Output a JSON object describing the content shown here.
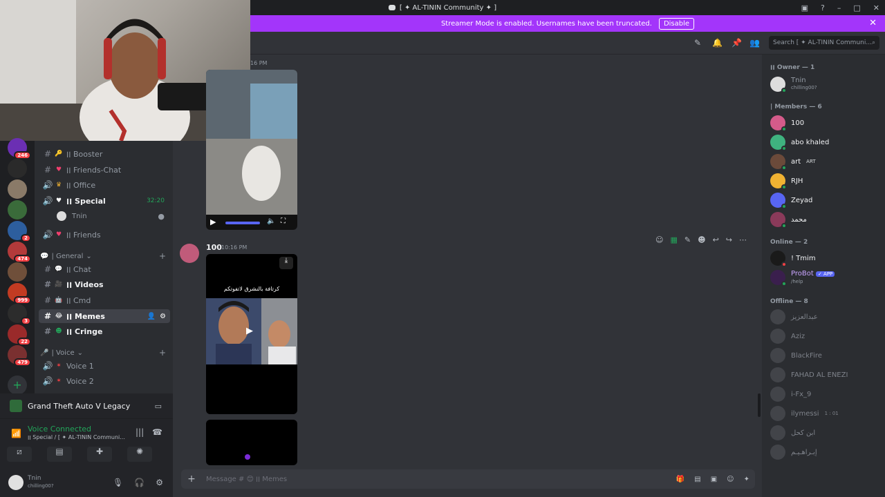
{
  "window": {
    "title": "[ ✦ AL-TININ Community ✦ ]"
  },
  "banner": {
    "text": "Streamer Mode is enabled. Usernames have been truncated.",
    "button": "Disable"
  },
  "search": {
    "placeholder": "Search [ ✦ AL-TININ Communi..."
  },
  "servers": [
    {
      "badge": "246"
    },
    {
      "badge": ""
    },
    {
      "badge": ""
    },
    {
      "badge": ""
    },
    {
      "badge": "2"
    },
    {
      "badge": "474"
    },
    {
      "badge": ""
    },
    {
      "badge": "999"
    },
    {
      "badge": "3"
    },
    {
      "badge": "22"
    },
    {
      "badge": "479"
    }
  ],
  "channels": {
    "booster": "׀׀ Booster",
    "friends_chat": "׀׀ Friends-Chat",
    "office": "׀׀ Office",
    "special": "׀׀ Special",
    "special_time": "32:20",
    "special_user": "Tnin",
    "friends": "׀׀ Friends",
    "cat_general": "| General",
    "chat": "׀׀ Chat",
    "videos": "׀׀ Videos",
    "cmd": "׀׀ Cmd",
    "memes": "׀׀ Memes",
    "cringe": "׀׀ Cringe",
    "cat_voice": "| Voice",
    "voice1": "Voice 1",
    "voice2": "Voice 2"
  },
  "game": {
    "name": "Grand Theft Auto V Legacy"
  },
  "voice": {
    "status": "Voice Connected",
    "channel": "׀׀ Special / [ ✦ AL-TININ Communi..."
  },
  "user": {
    "name": "Tnin",
    "status": "chilling00?"
  },
  "chat": {
    "prev_time": "16 PM",
    "msg_author": "100",
    "msg_time": "10:16 PM",
    "video_caption": "كرتافة بالنشرق لاتفوتكم",
    "composer_placeholder": "Message # 😊 ׀׀ Memes"
  },
  "members": {
    "owner_header": "׀׀ Owner — 1",
    "owner": {
      "name": "Tnin",
      "status": "chilling00?"
    },
    "members_header": "| Members — 6",
    "list": [
      {
        "name": "100",
        "color": "#f2f3f5"
      },
      {
        "name": "abo khaled",
        "color": "#f2f3f5"
      },
      {
        "name": "art",
        "tag": "ART",
        "color": "#f2f3f5"
      },
      {
        "name": "RJH",
        "color": "#f2f3f5"
      },
      {
        "name": "Zeyad",
        "color": "#f2f3f5"
      },
      {
        "name": "محمد",
        "color": "#f2f3f5"
      }
    ],
    "online_header": "Online — 2",
    "online": [
      {
        "name": "! Tmim"
      },
      {
        "name": "ProBot",
        "tag": "APP",
        "status": "/help"
      }
    ],
    "offline_header": "Offline — 8",
    "offline": [
      {
        "name": "عبدالعزيز"
      },
      {
        "name": "Aziz"
      },
      {
        "name": "BlackFire"
      },
      {
        "name": "FAHAD AL ENEZI"
      },
      {
        "name": "i-Fx_9"
      },
      {
        "name": "ilymessi",
        "status": "1 : 01"
      },
      {
        "name": "ابن كحل"
      },
      {
        "name": "إبـراهـيـم"
      }
    ]
  },
  "colors": {
    "accent": "#a335fa",
    "blurple": "#5865f2",
    "online": "#23a55a",
    "red": "#f23f43"
  }
}
